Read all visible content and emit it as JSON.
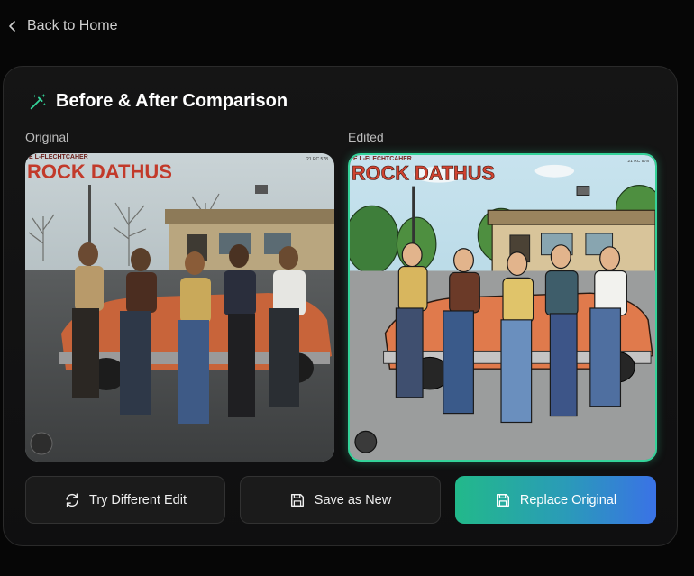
{
  "nav": {
    "back_label": "Back to Home"
  },
  "comparison": {
    "title": "Before & After Comparison",
    "original_label": "Original",
    "edited_label": "Edited",
    "album_title": "ROCK DATHUS",
    "album_header": "E L-FLECHTCAHER",
    "album_code": "21 RC 578"
  },
  "actions": {
    "try_label": "Try Different Edit",
    "save_label": "Save as New",
    "replace_label": "Replace Original"
  },
  "colors": {
    "accent_green": "#34d399",
    "accent_blue": "#3a72e6"
  }
}
